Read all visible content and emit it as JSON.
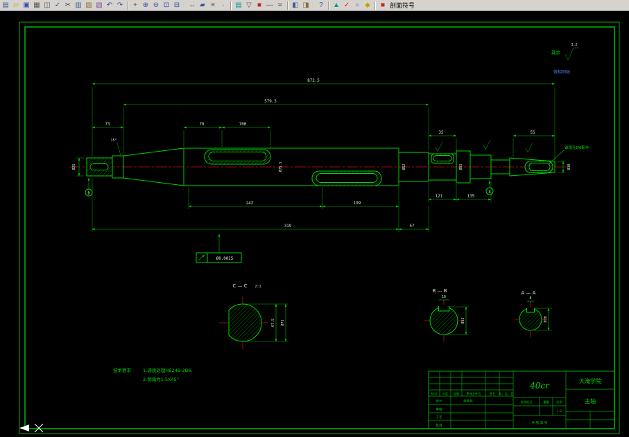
{
  "toolbar": {
    "section_label": "剖面符号",
    "icons": [
      {
        "name": "new-file",
        "glyph": "▤",
        "color": "#3a5a9c"
      },
      {
        "name": "open-file",
        "glyph": "▱",
        "color": "#c8a000"
      },
      {
        "name": "save-file",
        "glyph": "▣",
        "color": "#2f4fae"
      },
      {
        "name": "print",
        "glyph": "▦",
        "color": "#555555"
      },
      {
        "name": "print-preview",
        "glyph": "◫",
        "color": "#555555"
      },
      {
        "name": "spell-check",
        "glyph": "✓",
        "color": "#2f4fae"
      },
      {
        "name": "cut",
        "glyph": "✂",
        "color": "#444444"
      },
      {
        "name": "copy",
        "glyph": "▥",
        "color": "#3a5a9c"
      },
      {
        "name": "paste",
        "glyph": "▨",
        "color": "#8a6d2f"
      },
      {
        "name": "match-properties",
        "glyph": "▧",
        "color": "#7a4f9c"
      },
      {
        "name": "undo",
        "glyph": "↶",
        "color": "#2f4fae"
      },
      {
        "name": "redo",
        "glyph": "↷",
        "color": "#2f4fae"
      },
      {
        "sep": true
      },
      {
        "name": "pan",
        "glyph": "+",
        "color": "#555555"
      },
      {
        "name": "zoom-realtime",
        "glyph": "⊕",
        "color": "#2f4fae"
      },
      {
        "name": "zoom-out",
        "glyph": "⊖",
        "color": "#2f4fae"
      },
      {
        "name": "zoom-window",
        "glyph": "⊡",
        "color": "#2f4fae"
      },
      {
        "name": "zoom-previous",
        "glyph": "⊟",
        "color": "#2f4fae"
      },
      {
        "sep": true
      },
      {
        "name": "distance",
        "glyph": "↔",
        "color": "#555555"
      },
      {
        "name": "area",
        "glyph": "▰",
        "color": "#3a5a9c"
      },
      {
        "name": "list",
        "glyph": "≡",
        "color": "#555555"
      },
      {
        "name": "locate-point",
        "glyph": "∙",
        "color": "#555555"
      },
      {
        "sep": true
      },
      {
        "name": "layers",
        "glyph": "▤",
        "color": "#009999"
      },
      {
        "name": "layer-control",
        "glyph": "▽",
        "color": "#555555"
      },
      {
        "name": "color-control",
        "glyph": "■",
        "color": "#cc2222"
      },
      {
        "name": "linetype",
        "glyph": "—",
        "color": "#555555"
      },
      {
        "name": "lineweight",
        "glyph": "≍",
        "color": "#555555"
      },
      {
        "sep": true
      },
      {
        "name": "properties",
        "glyph": "◧",
        "color": "#3a5a9c"
      },
      {
        "name": "design-center",
        "glyph": "◨",
        "color": "#8a6d2f"
      },
      {
        "sep": true
      },
      {
        "name": "help",
        "glyph": "?",
        "color": "#2f4fae"
      },
      {
        "sep": true
      },
      {
        "name": "tool-triangle",
        "glyph": "▲",
        "color": "#009999"
      },
      {
        "name": "tool-check",
        "glyph": "✓",
        "color": "#cc2222"
      },
      {
        "name": "tool-circle",
        "glyph": "○",
        "color": "#2f4fae"
      },
      {
        "name": "tool-diamond",
        "glyph": "◆",
        "color": "#c8a000"
      },
      {
        "sep": true
      },
      {
        "name": "section-symbol",
        "glyph": "■",
        "color": "#cc2222"
      }
    ]
  },
  "dims": {
    "overall": "872.5",
    "mid": "579.3",
    "left73": "73",
    "seg70": "70",
    "seg700": "700",
    "seg35": "35",
    "seg55": "55",
    "chamfer15": "15°",
    "bot242": "242",
    "bot199": "199",
    "bot121": "121",
    "bot135": "135",
    "bot319": "319",
    "bot57": "57",
    "tol": "Ø0.0025",
    "dia_left": "Ø25",
    "dia_mid": "Ø75.5",
    "dia_r1": "Ø52",
    "dia_r2": "Ø55",
    "dia_end": "Ø30",
    "taper_note": "锥销孔Ø6配作"
  },
  "roughness": {
    "rest_label": "其余",
    "rest_value": "3.2",
    "axis_note": "做相同轴"
  },
  "datum": {
    "left": "B",
    "right": "A"
  },
  "sections": {
    "c": {
      "label": "C — C",
      "scale": "2:1",
      "dim_flat": "67.5",
      "dim_dia": "Ø75"
    },
    "b": {
      "label": "B — B",
      "dim_key": "16",
      "dim_dia": "Ø52"
    },
    "a": {
      "label": "A — A",
      "dim_key": "8",
      "dim_dia": "Ø30"
    }
  },
  "notes": {
    "title": "技术要求",
    "line1": "1.调质处理HB24B-2B6.",
    "line2": "2.倒角为1.5X45°"
  },
  "titleblock": {
    "material": "40cr",
    "company": "大淹学院",
    "part": "主轴",
    "rev_headers": [
      "标记",
      "处数",
      "分区",
      "更改文件号",
      "签名",
      "年、月、日"
    ],
    "roles": {
      "design": "设计",
      "standard": "标准化",
      "check": "审核",
      "process": "工艺",
      "approve": "批准"
    },
    "stage": "阶段标记",
    "weight": "重量",
    "scale_label": "比例",
    "scale_value": "1:2",
    "sheets": "共 张  第 张"
  }
}
